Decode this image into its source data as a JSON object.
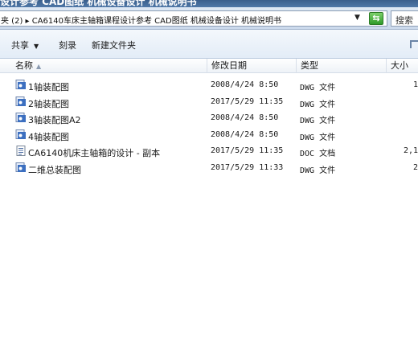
{
  "window": {
    "title": "设计参考 CAD图纸 机械设备设计 机械说明书"
  },
  "address": {
    "path": "夹 (2) ▸ CA6140车床主轴箱课程设计参考 CAD图纸 机械设备设计 机械说明书",
    "dropdown_glyph": "▼",
    "refresh_glyph": "⇆"
  },
  "search": {
    "label": "搜索"
  },
  "toolbar": {
    "share_label": "共享",
    "share_caret": "▼",
    "burn_label": "刻录",
    "new_folder_label": "新建文件夹"
  },
  "columns": {
    "name": "名称",
    "sort_glyph": "▲",
    "date": "修改日期",
    "type": "类型",
    "size": "大小"
  },
  "files": [
    {
      "name": "1轴装配图",
      "date": "2008/4/24 8:50",
      "type": "DWG 文件",
      "size": "1",
      "icon": "dwg-file-icon"
    },
    {
      "name": "2轴装配图",
      "date": "2017/5/29 11:35",
      "type": "DWG 文件",
      "size": "",
      "icon": "dwg-file-icon"
    },
    {
      "name": "3轴装配图A2",
      "date": "2008/4/24 8:50",
      "type": "DWG 文件",
      "size": "",
      "icon": "dwg-file-icon"
    },
    {
      "name": "4轴装配图",
      "date": "2008/4/24 8:50",
      "type": "DWG 文件",
      "size": "",
      "icon": "dwg-file-icon"
    },
    {
      "name": "CA6140机床主轴箱的设计 - 副本",
      "date": "2017/5/29 11:35",
      "type": "DOC 文档",
      "size": "2,1",
      "icon": "doc-file-icon"
    },
    {
      "name": "二维总装配图",
      "date": "2017/5/29 11:33",
      "type": "DWG 文件",
      "size": "2",
      "icon": "dwg-file-icon"
    }
  ]
}
